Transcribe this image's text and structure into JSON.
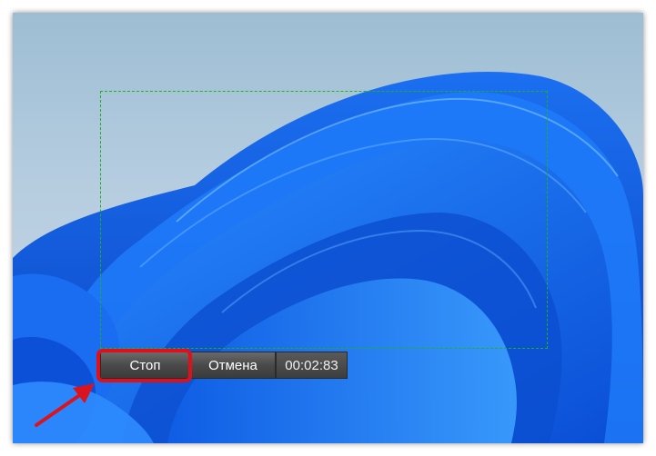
{
  "recorder": {
    "stop_label": "Стоп",
    "cancel_label": "Отмена",
    "elapsed_time": "00:02:83"
  },
  "annotation": {
    "highlight_color": "#e0101a",
    "arrow_color": "#d9141e",
    "selection_border_color": "#1db31d"
  },
  "wallpaper": {
    "background_top": "#9dbdd3",
    "bloom_color": "#1c73f0"
  }
}
